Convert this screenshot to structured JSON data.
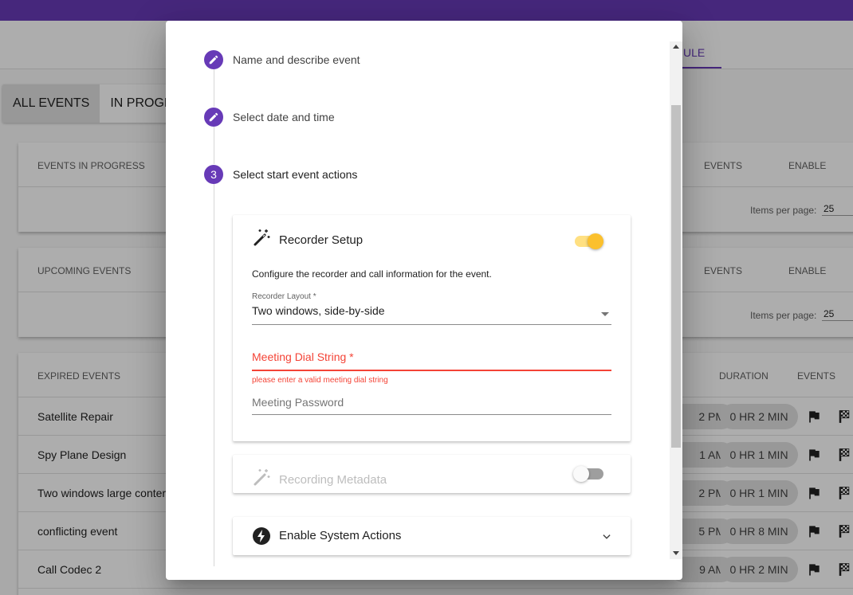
{
  "background": {
    "active_tab": "ULE",
    "view_toggle": [
      "ALL EVENTS",
      "IN PROGRE"
    ],
    "in_progress_card": {
      "title": "EVENTS IN PROGRESS",
      "col_events": "EVENTS",
      "col_enable": "ENABLE",
      "items_per_page_label": "Items per page:",
      "items_per_page": "25"
    },
    "upcoming_card": {
      "title": "UPCOMING EVENTS",
      "col_events": "EVENTS",
      "col_enable": "ENABLE",
      "items_per_page_label": "Items per page:",
      "items_per_page": "25"
    },
    "expired_card": {
      "title": "EXPIRED EVENTS",
      "col_duration": "DURATION",
      "col_events": "EVENTS",
      "rows": [
        {
          "name": "Satellite Repair",
          "time": "2 PM",
          "duration": "0 HR 2 MIN"
        },
        {
          "name": "Spy Plane Design",
          "time": "1 AM",
          "duration": "0 HR 1 MIN"
        },
        {
          "name": "Two windows large conter",
          "time": "2 PM",
          "duration": "0 HR 1 MIN"
        },
        {
          "name": "conflicting event",
          "time": "5 PM",
          "duration": "0 HR 8 MIN"
        },
        {
          "name": "Call Codec 2",
          "time": "9 AM",
          "duration": "0 HR 2 MIN"
        }
      ]
    }
  },
  "dialog": {
    "steps": [
      {
        "label": "Name and describe event",
        "icon": "pencil-icon"
      },
      {
        "label": "Select date and time",
        "icon": "pencil-icon"
      },
      {
        "label": "Select start event actions",
        "number": "3"
      }
    ],
    "recorder_setup": {
      "title": "Recorder Setup",
      "enabled": true,
      "description": "Configure the recorder and call information for the event.",
      "layout_label": "Recorder Layout *",
      "layout_value": "Two windows, side-by-side",
      "dial_string_label": "Meeting Dial String *",
      "dial_string_error": "please enter a valid meeting dial string",
      "password_placeholder": "Meeting Password"
    },
    "recording_metadata": {
      "title": "Recording Metadata",
      "enabled": false
    },
    "system_actions": {
      "title": "Enable System Actions"
    }
  },
  "colors": {
    "primary": "#673ab7",
    "accent": "#ffc107",
    "error": "#f44336"
  }
}
